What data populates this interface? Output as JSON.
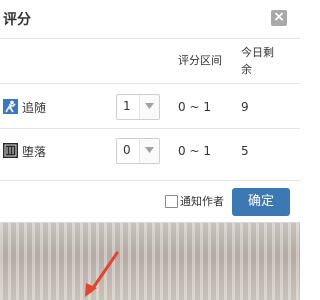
{
  "dialog": {
    "title": "评分",
    "close_glyph": "×",
    "columns": {
      "range": "评分区间",
      "remaining": "今日剩余"
    },
    "rows": [
      {
        "icon": "follow-icon",
        "label": "追随",
        "score": "1",
        "range": "0 ~ 1",
        "remaining": "9"
      },
      {
        "icon": "fall-icon",
        "label": "堕落",
        "score": "0",
        "range": "0 ~ 1",
        "remaining": "5"
      }
    ],
    "notify_label": "通知作者",
    "notify_checked": false,
    "confirm_label": "确定"
  },
  "colors": {
    "confirm_button": "#3c78b4",
    "close_button": "#a9a9a9",
    "arrow_annotation": "#e8412c"
  }
}
